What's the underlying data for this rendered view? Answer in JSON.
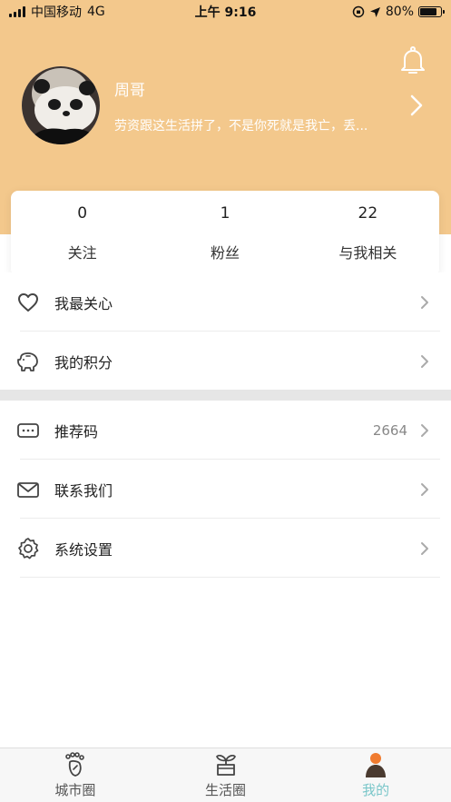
{
  "status_bar": {
    "carrier": "中国移动",
    "network": "4G",
    "time": "上午 9:16",
    "battery_percent": "80%",
    "battery_level": 0.8
  },
  "profile": {
    "username": "周哥",
    "signature": "劳资跟这生活拼了，不是你死就是我亡，丢..."
  },
  "stats": [
    {
      "value": "0",
      "label": "关注"
    },
    {
      "value": "1",
      "label": "粉丝"
    },
    {
      "value": "22",
      "label": "与我相关"
    }
  ],
  "menu_top": [
    {
      "label": "我最关心",
      "icon": "heart-icon"
    },
    {
      "label": "我的积分",
      "icon": "piggy-bank-icon"
    }
  ],
  "menu_bottom": [
    {
      "label": "推荐码",
      "value": "2664",
      "icon": "keyboard-icon"
    },
    {
      "label": "联系我们",
      "icon": "mail-icon"
    },
    {
      "label": "系统设置",
      "icon": "gear-icon"
    }
  ],
  "tabs": [
    {
      "label": "城市圈",
      "icon": "footprint-icon"
    },
    {
      "label": "生活圈",
      "icon": "plant-pot-icon"
    },
    {
      "label": "我的",
      "icon": "person-icon",
      "active": true
    }
  ],
  "colors": {
    "header": "#f3c88c",
    "active_tab": "#79c6c9",
    "active_tab_icon_head": "#f07b2f",
    "active_tab_icon_body": "#4a3a30"
  }
}
